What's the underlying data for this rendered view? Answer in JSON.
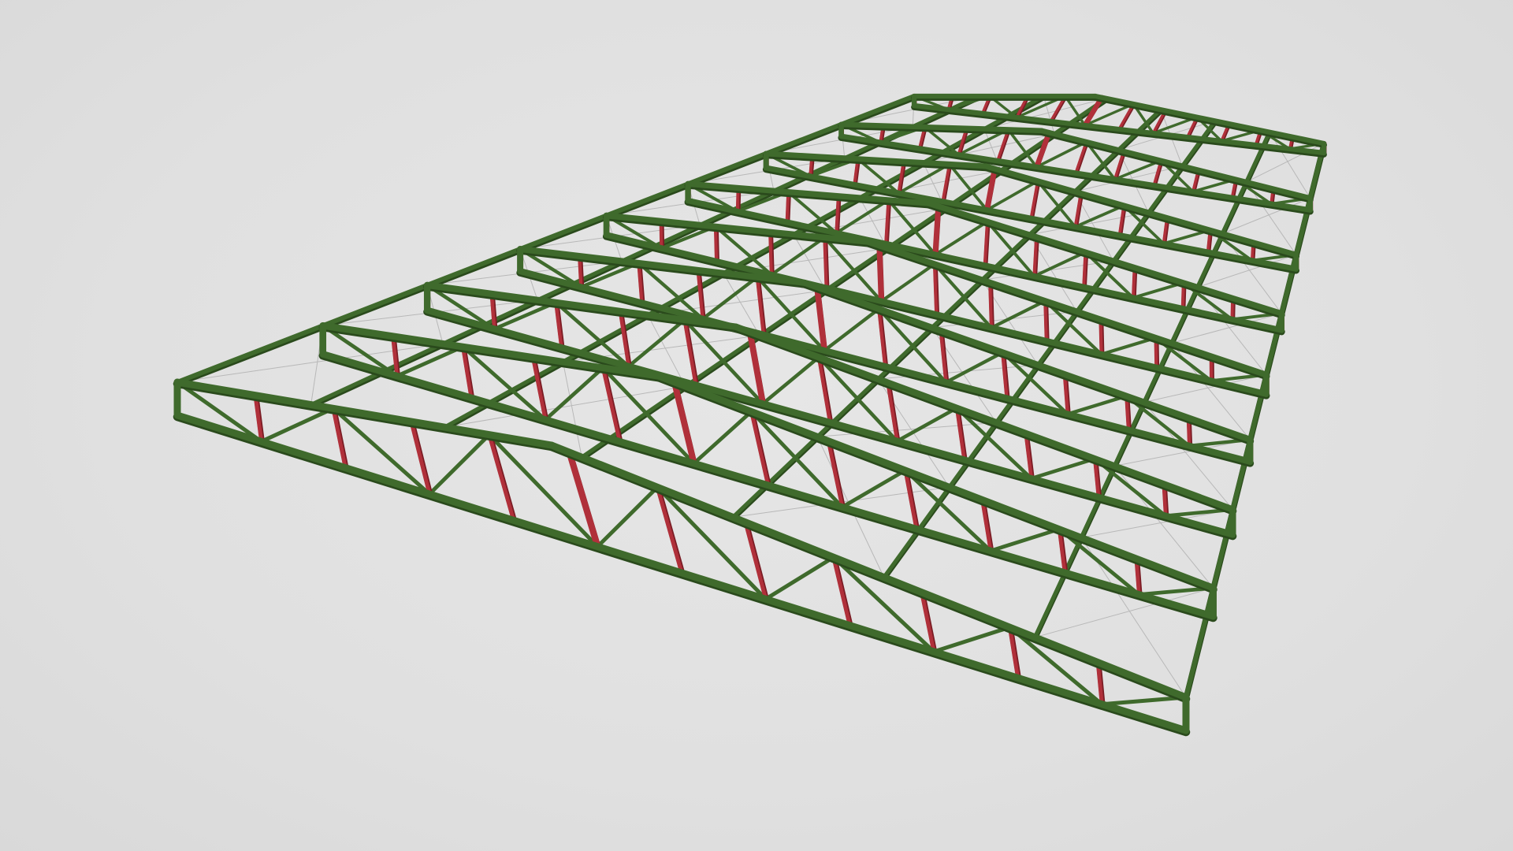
{
  "scene": {
    "background_color": "#e2e2e2",
    "colors": {
      "chord": "#3f6a2c",
      "chord_shadow": "#2a4a1c",
      "post": "#b0303a",
      "post_shadow": "#7a1c24",
      "wire": "#b8b8b8"
    },
    "trusses": 9,
    "purlin_lines": 7
  }
}
